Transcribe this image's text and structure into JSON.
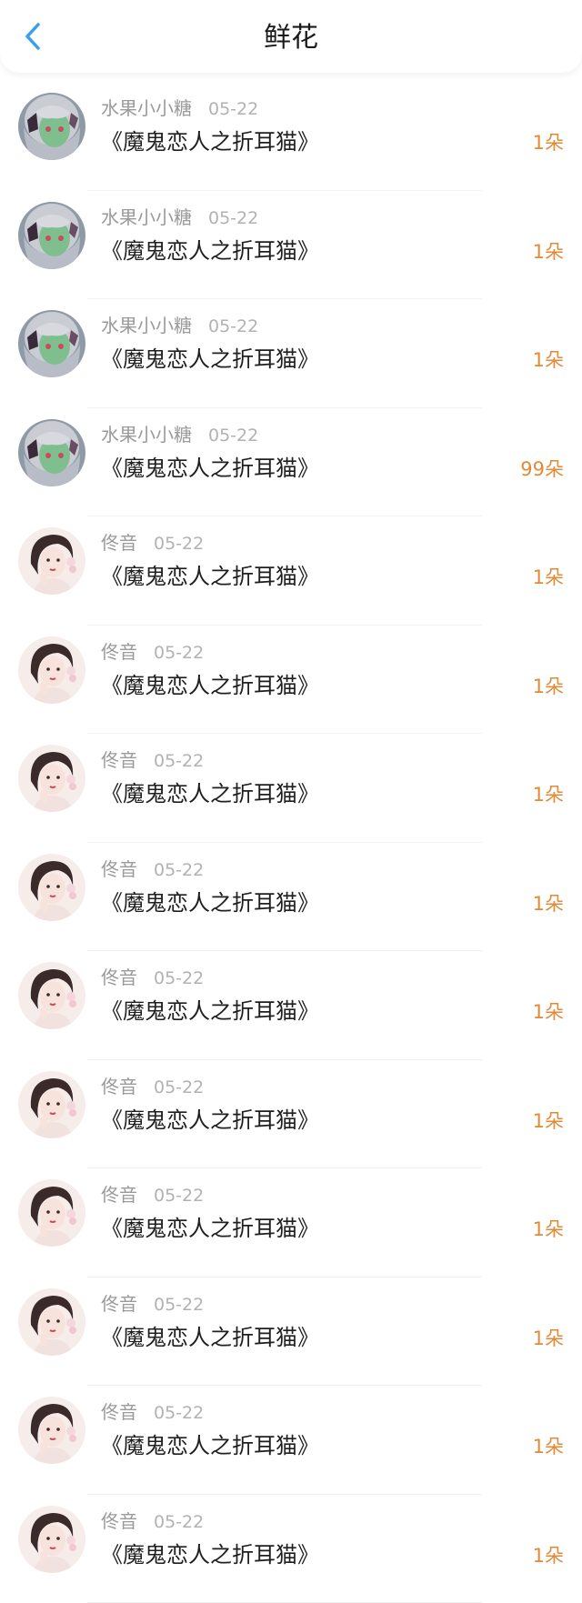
{
  "header": {
    "title": "鲜花",
    "back_icon": "chevron-left-icon",
    "back_color": "#3a9ee8"
  },
  "accent_color": "#e28a38",
  "records": [
    {
      "user": "水果小小糖",
      "date": "05-22",
      "title": "《魔鬼恋人之折耳猫》",
      "count": "1朵",
      "avatar": "anime-girl-avatar"
    },
    {
      "user": "水果小小糖",
      "date": "05-22",
      "title": "《魔鬼恋人之折耳猫》",
      "count": "1朵",
      "avatar": "anime-girl-avatar"
    },
    {
      "user": "水果小小糖",
      "date": "05-22",
      "title": "《魔鬼恋人之折耳猫》",
      "count": "1朵",
      "avatar": "anime-girl-avatar"
    },
    {
      "user": "水果小小糖",
      "date": "05-22",
      "title": "《魔鬼恋人之折耳猫》",
      "count": "99朵",
      "avatar": "anime-girl-avatar"
    },
    {
      "user": "佟音",
      "date": "05-22",
      "title": "《魔鬼恋人之折耳猫》",
      "count": "1朵",
      "avatar": "woman-portrait-avatar"
    },
    {
      "user": "佟音",
      "date": "05-22",
      "title": "《魔鬼恋人之折耳猫》",
      "count": "1朵",
      "avatar": "woman-portrait-avatar"
    },
    {
      "user": "佟音",
      "date": "05-22",
      "title": "《魔鬼恋人之折耳猫》",
      "count": "1朵",
      "avatar": "woman-portrait-avatar"
    },
    {
      "user": "佟音",
      "date": "05-22",
      "title": "《魔鬼恋人之折耳猫》",
      "count": "1朵",
      "avatar": "woman-portrait-avatar"
    },
    {
      "user": "佟音",
      "date": "05-22",
      "title": "《魔鬼恋人之折耳猫》",
      "count": "1朵",
      "avatar": "woman-portrait-avatar"
    },
    {
      "user": "佟音",
      "date": "05-22",
      "title": "《魔鬼恋人之折耳猫》",
      "count": "1朵",
      "avatar": "woman-portrait-avatar"
    },
    {
      "user": "佟音",
      "date": "05-22",
      "title": "《魔鬼恋人之折耳猫》",
      "count": "1朵",
      "avatar": "woman-portrait-avatar"
    },
    {
      "user": "佟音",
      "date": "05-22",
      "title": "《魔鬼恋人之折耳猫》",
      "count": "1朵",
      "avatar": "woman-portrait-avatar"
    },
    {
      "user": "佟音",
      "date": "05-22",
      "title": "《魔鬼恋人之折耳猫》",
      "count": "1朵",
      "avatar": "woman-portrait-avatar"
    },
    {
      "user": "佟音",
      "date": "05-22",
      "title": "《魔鬼恋人之折耳猫》",
      "count": "1朵",
      "avatar": "woman-portrait-avatar"
    }
  ]
}
